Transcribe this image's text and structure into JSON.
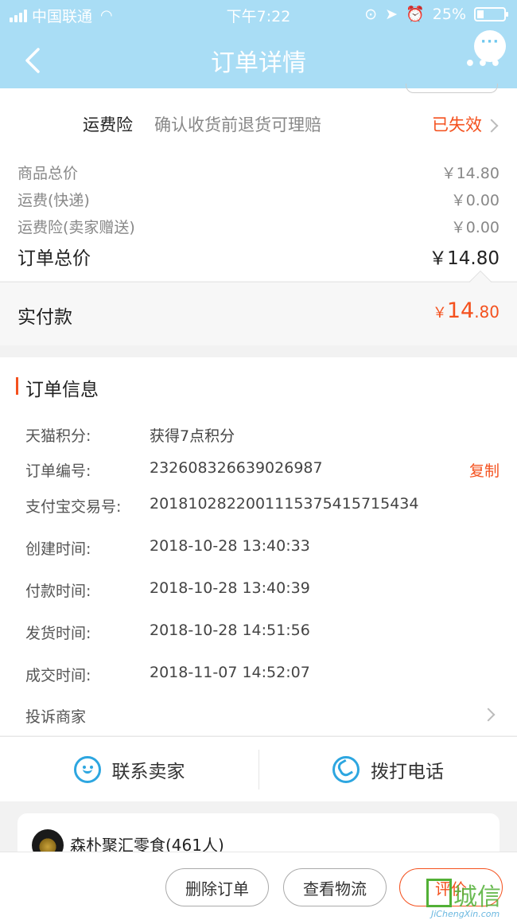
{
  "status_bar": {
    "carrier": "中国联通",
    "time": "下午7:22",
    "battery": "25%"
  },
  "nav": {
    "title": "订单详情"
  },
  "insurance": {
    "name": "运费险",
    "desc": "确认收货前退货可理赔",
    "status": "已失效"
  },
  "prices": {
    "rows": [
      {
        "label": "商品总价",
        "value": "￥14.80"
      },
      {
        "label": "运费(快递)",
        "value": "￥0.00"
      },
      {
        "label": "运费险(卖家赠送)",
        "value": "￥0.00"
      }
    ],
    "total_label": "订单总价",
    "total_value": "￥14.80"
  },
  "paid": {
    "label": "实付款",
    "currency": "￥",
    "int": "14",
    "dec": ".80"
  },
  "order_info": {
    "title": "订单信息",
    "rows": [
      {
        "label": "天猫积分:",
        "value": "获得7点积分"
      },
      {
        "label": "订单编号:",
        "value": "232608326639026987",
        "action": "复制"
      },
      {
        "label": "支付宝交易号:",
        "value": "2018102822001115375415715434"
      },
      {
        "label": "创建时间:",
        "value": "2018-10-28 13:40:33"
      },
      {
        "label": "付款时间:",
        "value": "2018-10-28 13:40:39"
      },
      {
        "label": "发货时间:",
        "value": "2018-10-28 14:51:56"
      },
      {
        "label": "成交时间:",
        "value": "2018-11-07 14:52:07"
      }
    ],
    "complain": "投诉商家"
  },
  "contact": {
    "seller": "联系卖家",
    "call": "拨打电话"
  },
  "shop": {
    "name": "森朴聚汇零食(461人)"
  },
  "actions": {
    "delete": "删除订单",
    "logistics": "查看物流",
    "review": "评价"
  },
  "watermark": {
    "text": "城信",
    "url": "JiChengXin.com"
  },
  "colors": {
    "header": "#a9ddf5",
    "accent": "#f4511e",
    "icon_blue": "#2da6e0"
  }
}
